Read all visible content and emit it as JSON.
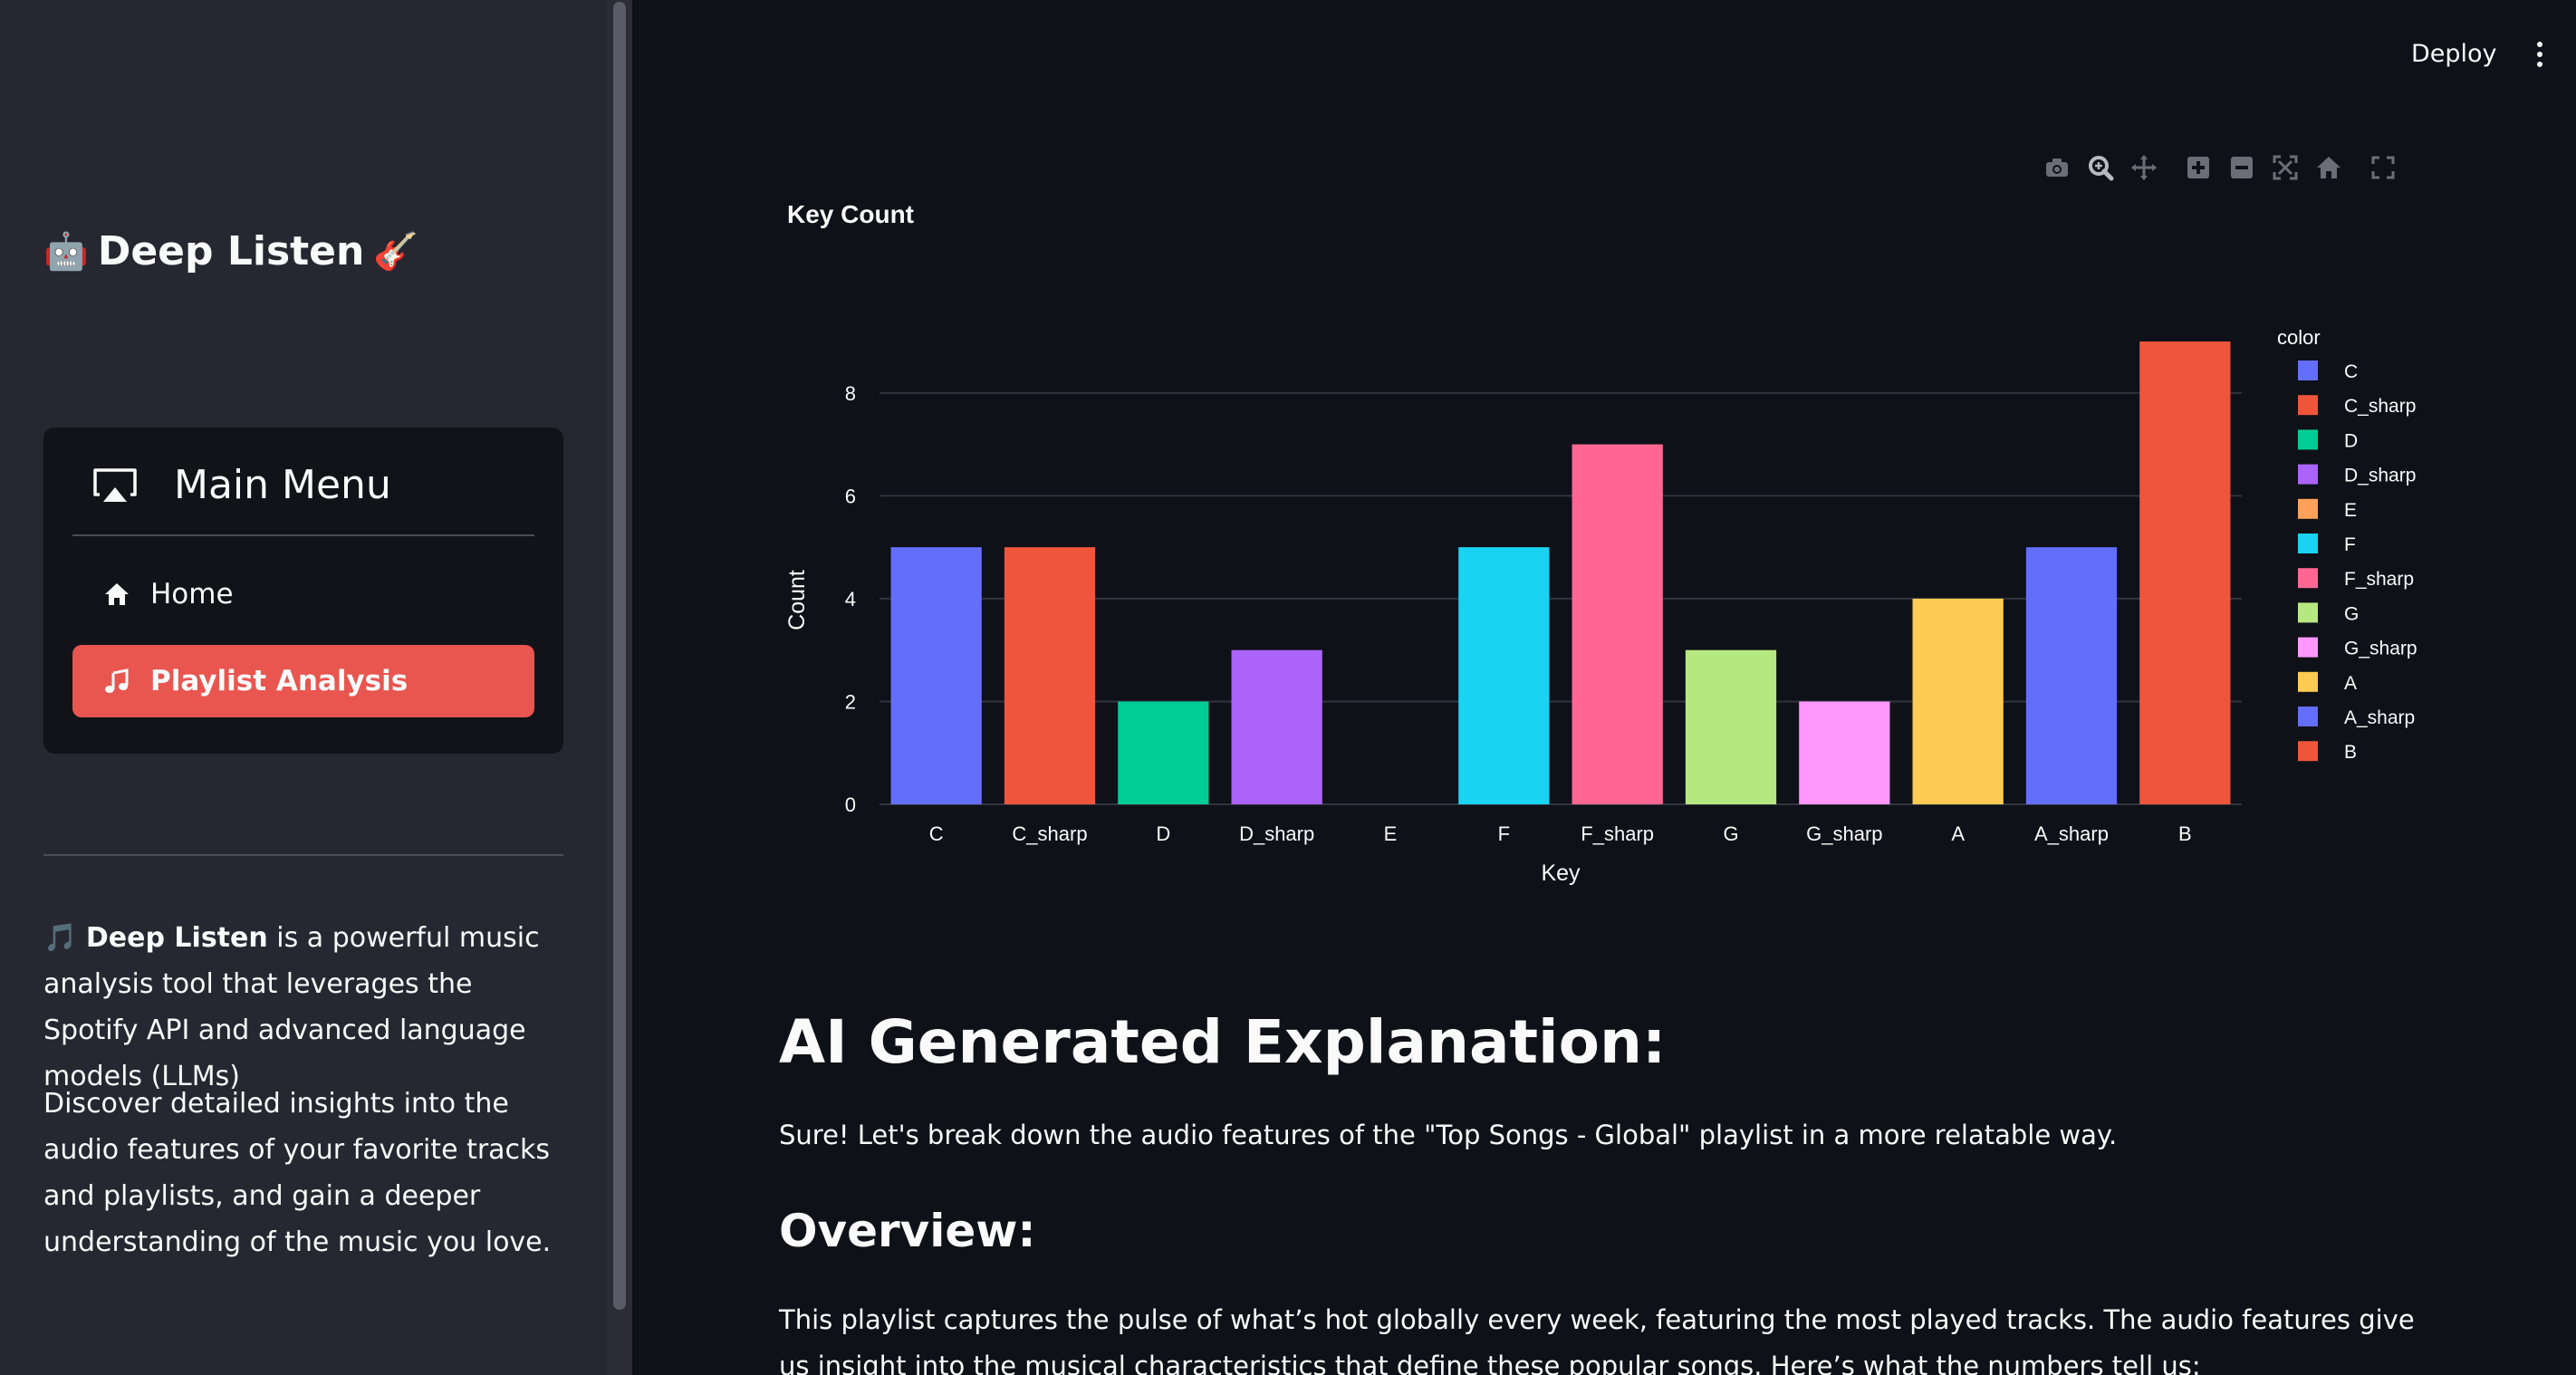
{
  "sidebar": {
    "app_title": "Deep Listen",
    "title_left_emoji": "🤖",
    "title_right_emoji": "🎸",
    "menu": {
      "title": "Main Menu",
      "items": [
        {
          "label": "Home",
          "icon": "house-icon",
          "active": false
        },
        {
          "label": "Playlist Analysis",
          "icon": "music-note-icon",
          "active": true
        }
      ]
    },
    "description": {
      "p1_emoji": "🎵",
      "p1_bold": "Deep Listen",
      "p1_rest": " is a powerful music analysis tool that leverages the Spotify API and advanced language models (LLMs)",
      "p2": "Discover detailed insights into the audio features of your favorite tracks and playlists, and gain a deeper understanding of the music you love."
    }
  },
  "header": {
    "deploy_label": "Deploy",
    "menu_icon": "kebab-menu-icon"
  },
  "modebar": [
    "camera-icon",
    "zoom-icon",
    "pan-icon",
    "zoom-in-icon",
    "zoom-out-icon",
    "autoscale-icon",
    "reset-axes-icon",
    "fullscreen-icon"
  ],
  "chart_data": {
    "type": "bar",
    "title": "Key Count",
    "xlabel": "Key",
    "ylabel": "Count",
    "ylim": [
      0,
      9
    ],
    "yticks": [
      0,
      2,
      4,
      6,
      8
    ],
    "grid": true,
    "legend_title": "color",
    "legend_position": "right",
    "categories": [
      "C",
      "C_sharp",
      "D",
      "D_sharp",
      "E",
      "F",
      "F_sharp",
      "G",
      "G_sharp",
      "A",
      "A_sharp",
      "B"
    ],
    "values": [
      5,
      5,
      2,
      3,
      0,
      5,
      7,
      3,
      2,
      4,
      5,
      9
    ],
    "colors": [
      "#636efa",
      "#ef553b",
      "#00cc96",
      "#ab63fa",
      "#ffa15a",
      "#19d3f3",
      "#ff6692",
      "#b6e880",
      "#ff97ff",
      "#fecb52",
      "#636efa",
      "#ef553b"
    ]
  },
  "main": {
    "heading": "AI Generated Explanation:",
    "intro": "Sure! Let's break down the audio features of the \"Top Songs - Global\" playlist in a more relatable way.",
    "overview_heading": "Overview:",
    "overview_text": "This playlist captures the pulse of what’s hot globally every week, featuring the most played tracks. The audio features give us insight into the musical characteristics that define these popular songs. Here’s what the numbers tell us:"
  }
}
